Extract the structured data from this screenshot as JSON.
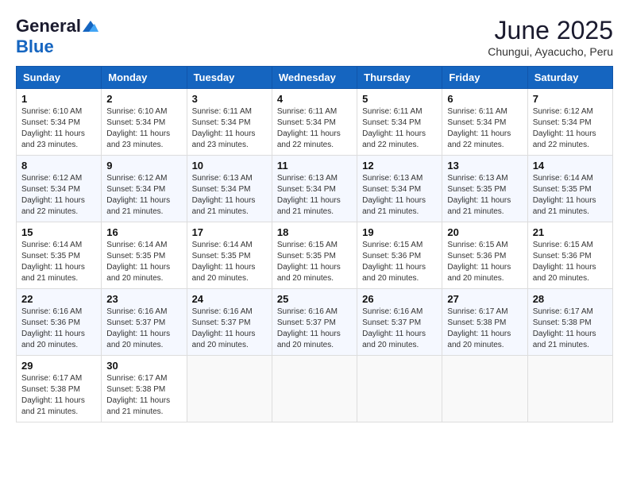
{
  "logo": {
    "general": "General",
    "blue": "Blue"
  },
  "title": "June 2025",
  "location": "Chungui, Ayacucho, Peru",
  "weekdays": [
    "Sunday",
    "Monday",
    "Tuesday",
    "Wednesday",
    "Thursday",
    "Friday",
    "Saturday"
  ],
  "weeks": [
    [
      {
        "day": "1",
        "info": "Sunrise: 6:10 AM\nSunset: 5:34 PM\nDaylight: 11 hours\nand 23 minutes."
      },
      {
        "day": "2",
        "info": "Sunrise: 6:10 AM\nSunset: 5:34 PM\nDaylight: 11 hours\nand 23 minutes."
      },
      {
        "day": "3",
        "info": "Sunrise: 6:11 AM\nSunset: 5:34 PM\nDaylight: 11 hours\nand 23 minutes."
      },
      {
        "day": "4",
        "info": "Sunrise: 6:11 AM\nSunset: 5:34 PM\nDaylight: 11 hours\nand 22 minutes."
      },
      {
        "day": "5",
        "info": "Sunrise: 6:11 AM\nSunset: 5:34 PM\nDaylight: 11 hours\nand 22 minutes."
      },
      {
        "day": "6",
        "info": "Sunrise: 6:11 AM\nSunset: 5:34 PM\nDaylight: 11 hours\nand 22 minutes."
      },
      {
        "day": "7",
        "info": "Sunrise: 6:12 AM\nSunset: 5:34 PM\nDaylight: 11 hours\nand 22 minutes."
      }
    ],
    [
      {
        "day": "8",
        "info": "Sunrise: 6:12 AM\nSunset: 5:34 PM\nDaylight: 11 hours\nand 22 minutes."
      },
      {
        "day": "9",
        "info": "Sunrise: 6:12 AM\nSunset: 5:34 PM\nDaylight: 11 hours\nand 21 minutes."
      },
      {
        "day": "10",
        "info": "Sunrise: 6:13 AM\nSunset: 5:34 PM\nDaylight: 11 hours\nand 21 minutes."
      },
      {
        "day": "11",
        "info": "Sunrise: 6:13 AM\nSunset: 5:34 PM\nDaylight: 11 hours\nand 21 minutes."
      },
      {
        "day": "12",
        "info": "Sunrise: 6:13 AM\nSunset: 5:34 PM\nDaylight: 11 hours\nand 21 minutes."
      },
      {
        "day": "13",
        "info": "Sunrise: 6:13 AM\nSunset: 5:35 PM\nDaylight: 11 hours\nand 21 minutes."
      },
      {
        "day": "14",
        "info": "Sunrise: 6:14 AM\nSunset: 5:35 PM\nDaylight: 11 hours\nand 21 minutes."
      }
    ],
    [
      {
        "day": "15",
        "info": "Sunrise: 6:14 AM\nSunset: 5:35 PM\nDaylight: 11 hours\nand 21 minutes."
      },
      {
        "day": "16",
        "info": "Sunrise: 6:14 AM\nSunset: 5:35 PM\nDaylight: 11 hours\nand 20 minutes."
      },
      {
        "day": "17",
        "info": "Sunrise: 6:14 AM\nSunset: 5:35 PM\nDaylight: 11 hours\nand 20 minutes."
      },
      {
        "day": "18",
        "info": "Sunrise: 6:15 AM\nSunset: 5:35 PM\nDaylight: 11 hours\nand 20 minutes."
      },
      {
        "day": "19",
        "info": "Sunrise: 6:15 AM\nSunset: 5:36 PM\nDaylight: 11 hours\nand 20 minutes."
      },
      {
        "day": "20",
        "info": "Sunrise: 6:15 AM\nSunset: 5:36 PM\nDaylight: 11 hours\nand 20 minutes."
      },
      {
        "day": "21",
        "info": "Sunrise: 6:15 AM\nSunset: 5:36 PM\nDaylight: 11 hours\nand 20 minutes."
      }
    ],
    [
      {
        "day": "22",
        "info": "Sunrise: 6:16 AM\nSunset: 5:36 PM\nDaylight: 11 hours\nand 20 minutes."
      },
      {
        "day": "23",
        "info": "Sunrise: 6:16 AM\nSunset: 5:37 PM\nDaylight: 11 hours\nand 20 minutes."
      },
      {
        "day": "24",
        "info": "Sunrise: 6:16 AM\nSunset: 5:37 PM\nDaylight: 11 hours\nand 20 minutes."
      },
      {
        "day": "25",
        "info": "Sunrise: 6:16 AM\nSunset: 5:37 PM\nDaylight: 11 hours\nand 20 minutes."
      },
      {
        "day": "26",
        "info": "Sunrise: 6:16 AM\nSunset: 5:37 PM\nDaylight: 11 hours\nand 20 minutes."
      },
      {
        "day": "27",
        "info": "Sunrise: 6:17 AM\nSunset: 5:38 PM\nDaylight: 11 hours\nand 20 minutes."
      },
      {
        "day": "28",
        "info": "Sunrise: 6:17 AM\nSunset: 5:38 PM\nDaylight: 11 hours\nand 21 minutes."
      }
    ],
    [
      {
        "day": "29",
        "info": "Sunrise: 6:17 AM\nSunset: 5:38 PM\nDaylight: 11 hours\nand 21 minutes."
      },
      {
        "day": "30",
        "info": "Sunrise: 6:17 AM\nSunset: 5:38 PM\nDaylight: 11 hours\nand 21 minutes."
      },
      {
        "day": "",
        "info": ""
      },
      {
        "day": "",
        "info": ""
      },
      {
        "day": "",
        "info": ""
      },
      {
        "day": "",
        "info": ""
      },
      {
        "day": "",
        "info": ""
      }
    ]
  ]
}
